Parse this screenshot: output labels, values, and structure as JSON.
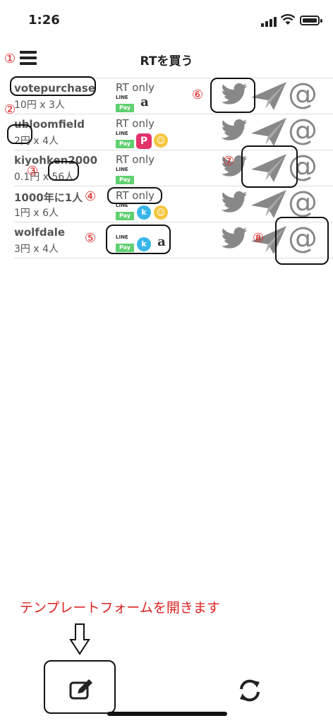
{
  "status": {
    "time": "1:26"
  },
  "header": {
    "title": "RTを買う",
    "menu_icon": "hamburger-menu-icon"
  },
  "rows": [
    {
      "user": "votepurchase",
      "price": "10円 x 3人",
      "rt_only": "RT only",
      "payments": [
        "line-pay",
        "amazon"
      ]
    },
    {
      "user": "ubloomfield",
      "price": "2円 x 4人",
      "rt_only": "RT only",
      "payments": [
        "line-pay",
        "paypay",
        "face"
      ]
    },
    {
      "user": "kiyohken2000",
      "price": "0.1円 x 56人",
      "rt_only": "RT only",
      "payments": [
        "line-pay"
      ]
    },
    {
      "user": "1000年に1人",
      "price": "1円 x 6人",
      "rt_only": "RT only",
      "payments": [
        "line-pay",
        "kyash",
        "face"
      ]
    },
    {
      "user": "wolfdale",
      "price": "3円 x 4人",
      "rt_only": "",
      "payments": [
        "line-pay",
        "kyash",
        "amazon"
      ]
    }
  ],
  "payment_labels": {
    "line": "LINE",
    "pay": "Pay",
    "amazon": "a",
    "paypay": "P",
    "kyash": "k",
    "face": "☺"
  },
  "row_icons": [
    "twitter-bird-icon",
    "paper-plane-send-icon",
    "at-mention-icon"
  ],
  "at_symbol": "@",
  "annotations": [
    "①",
    "②",
    "③",
    "④",
    "⑤",
    "⑥",
    "⑦",
    "⑧"
  ],
  "footer": {
    "caption": "テンプレートフォームを開きます",
    "compose_icon": "edit-compose-icon",
    "sync_icon": "refresh-sync-icon"
  },
  "colors": {
    "annotation": "#dd2222",
    "icon_gray": "#888888",
    "line_green": "#5fd06f"
  }
}
